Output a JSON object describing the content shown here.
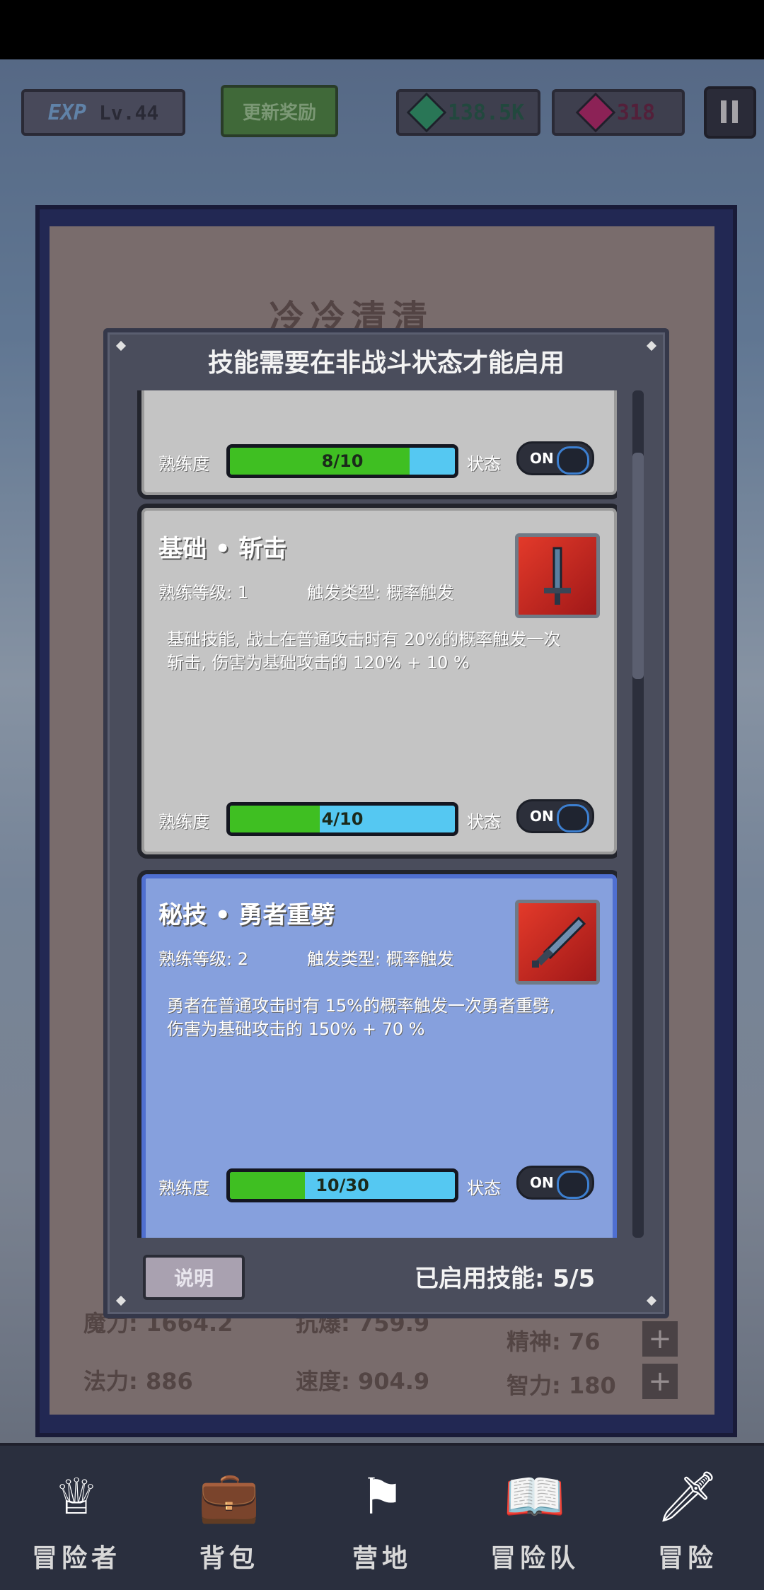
{
  "topbar": {
    "exp_badge": "EXP",
    "level": "Lv.44",
    "reward_button": "更新奖励",
    "green_currency": "138.5K",
    "red_currency": "318",
    "pause_icon": "pause-icon"
  },
  "under_panel": {
    "title": "冷冷清清",
    "stats": {
      "magic": "魔力: 1664.2",
      "anti_crit": "抗爆: 759.9",
      "mana": "法力: 886",
      "speed": "速度: 904.9",
      "spirit": "精神: 76",
      "intellect": "智力: 180"
    }
  },
  "modal": {
    "title": "技能需要在非战斗状态才能启用",
    "help_button": "说明",
    "enabled_count": "已启用技能: 5/5",
    "cards": [
      {
        "proficiency_label": "熟练度",
        "progress": "8/10",
        "progress_fraction": 0.8,
        "state_label": "状态",
        "toggle": "ON"
      },
      {
        "title": "基础 • 斩击",
        "level": "熟练等级: 1",
        "trigger": "触发类型: 概率触发",
        "description": "基础技能, 战士在普通攻击时有 20%的概率触发一次斩击, 伤害为基础攻击的 120% + 10 %",
        "proficiency_label": "熟练度",
        "progress": "4/10",
        "progress_fraction": 0.4,
        "state_label": "状态",
        "toggle": "ON",
        "icon": "sword-icon"
      },
      {
        "title": "秘技 • 勇者重劈",
        "level": "熟练等级: 2",
        "trigger": "触发类型: 概率触发",
        "description": "勇者在普通攻击时有 15%的概率触发一次勇者重劈, 伤害为基础攻击的 150% + 70 %",
        "proficiency_label": "熟练度",
        "progress": "10/30",
        "progress_fraction": 0.333,
        "state_label": "状态",
        "toggle": "ON",
        "icon": "greatsword-icon"
      }
    ]
  },
  "bottom_nav": [
    {
      "label": "冒险者",
      "icon": "helmet-icon"
    },
    {
      "label": "背包",
      "icon": "backpack-icon"
    },
    {
      "label": "营地",
      "icon": "banner-icon"
    },
    {
      "label": "冒险队",
      "icon": "book-icon"
    },
    {
      "label": "冒险",
      "icon": "sword-icon"
    }
  ],
  "colors": {
    "progress_green": "#3fbf22",
    "progress_blue": "#55c8f2",
    "selected_card": "#86a0dd",
    "modal_bg": "#4a4d5c"
  }
}
